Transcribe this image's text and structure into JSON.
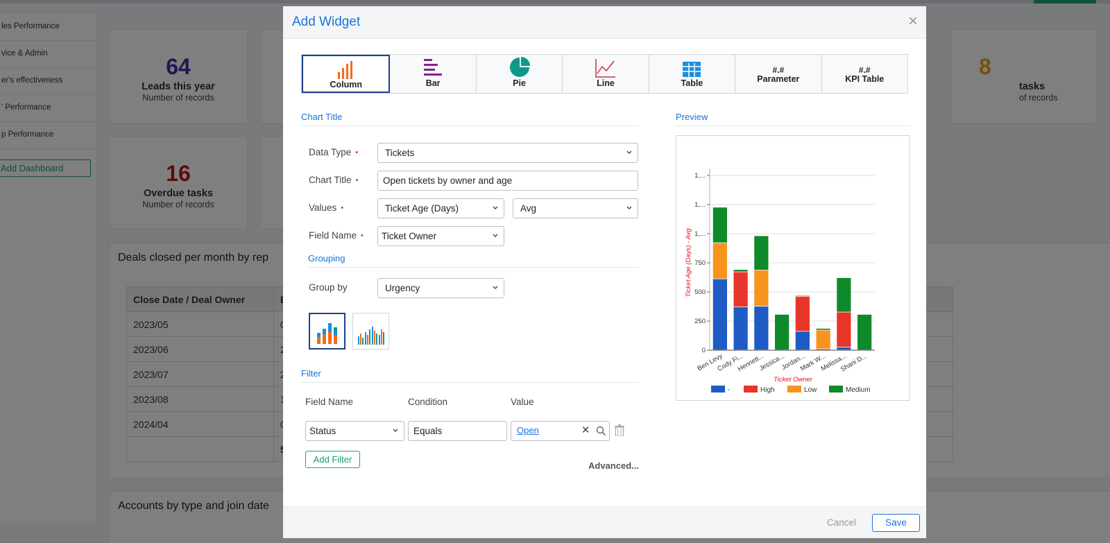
{
  "sidebar": {
    "items": [
      "les Performance",
      "vice & Admin",
      "er's effectiveness",
      "' Performance",
      "p Performance"
    ],
    "add_dashboard": "Add Dashboard"
  },
  "kpis": [
    {
      "value": "64",
      "label": "Leads this year",
      "sub": "Number of records",
      "color": "#3b30a8"
    },
    {
      "value": "16",
      "label": "Overdue tasks",
      "sub": "Number of records",
      "color": "#c0141f"
    },
    {
      "value": "8",
      "label": "tasks",
      "sub": "of records",
      "color": "#e9a21f"
    }
  ],
  "deals": {
    "title": "Deals closed per month by rep",
    "header": [
      "Close Date / Deal Owner",
      "E"
    ],
    "rows": [
      [
        "2023/05",
        "0"
      ],
      [
        "2023/06",
        "2"
      ],
      [
        "2023/07",
        "2"
      ],
      [
        "2023/08",
        "1"
      ],
      [
        "2024/04",
        "0"
      ],
      [
        "",
        "5"
      ]
    ]
  },
  "accounts": {
    "title": "Accounts by type and join date"
  },
  "modal": {
    "title": "Add Widget",
    "close": "×",
    "types": [
      {
        "label": "Column",
        "icon": "column-chart-icon"
      },
      {
        "label": "Bar",
        "icon": "bar-chart-icon"
      },
      {
        "label": "Pie",
        "icon": "pie-chart-icon"
      },
      {
        "label": "Line",
        "icon": "line-chart-icon"
      },
      {
        "label": "Table",
        "icon": "table-icon"
      },
      {
        "label": "Parameter",
        "hash": "#.#"
      },
      {
        "label": "KPI Table",
        "hash": "#.#"
      }
    ],
    "sections": {
      "chart_title": "Chart Title",
      "grouping": "Grouping",
      "filter": "Filter",
      "preview": "Preview"
    },
    "fields": {
      "data_type": {
        "label": "Data Type",
        "value": "Tickets"
      },
      "chart_title": {
        "label": "Chart Title",
        "value": "Open tickets by owner and age"
      },
      "values": {
        "label": "Values",
        "value": "Ticket Age (Days)",
        "agg": "Avg"
      },
      "field_name": {
        "label": "Field Name",
        "value": "Ticket Owner"
      },
      "group_by": {
        "label": "Group by",
        "value": "Urgency"
      }
    },
    "filter": {
      "headers": [
        "Field Name",
        "Condition",
        "Value"
      ],
      "field": "Status",
      "condition": "Equals",
      "value": "Open",
      "add_filter": "Add Filter",
      "advanced": "Advanced..."
    },
    "cancel": "Cancel",
    "save": "Save"
  },
  "chart_data": {
    "type": "bar",
    "stacked": true,
    "xlabel": "Ticket Owner",
    "ylabel": "Ticket Age (Days) - Avg",
    "ylim": [
      0,
      1500
    ],
    "yticks": [
      0,
      250,
      500,
      750,
      1000,
      1250,
      1500
    ],
    "ytick_labels": [
      "0",
      "250",
      "500",
      "750",
      "1,...",
      "1,...",
      "1,..."
    ],
    "categories": [
      "Ben Levy",
      "Cody Fi...",
      "Henriett...",
      "Jessica...",
      "Jordan...",
      "Mark W...",
      "Melissa...",
      "Shani D..."
    ],
    "series": [
      {
        "name": "-",
        "color": "#1f5bc4",
        "values": [
          610,
          370,
          375,
          0,
          160,
          0,
          25,
          0
        ]
      },
      {
        "name": "High",
        "color": "#e8352a",
        "values": [
          0,
          300,
          0,
          0,
          300,
          10,
          300,
          0
        ]
      },
      {
        "name": "Low",
        "color": "#f7941d",
        "values": [
          310,
          0,
          310,
          0,
          10,
          160,
          0,
          0
        ]
      },
      {
        "name": "Medium",
        "color": "#0f8a2a",
        "values": [
          305,
          20,
          295,
          305,
          0,
          15,
          295,
          305
        ]
      }
    ]
  }
}
